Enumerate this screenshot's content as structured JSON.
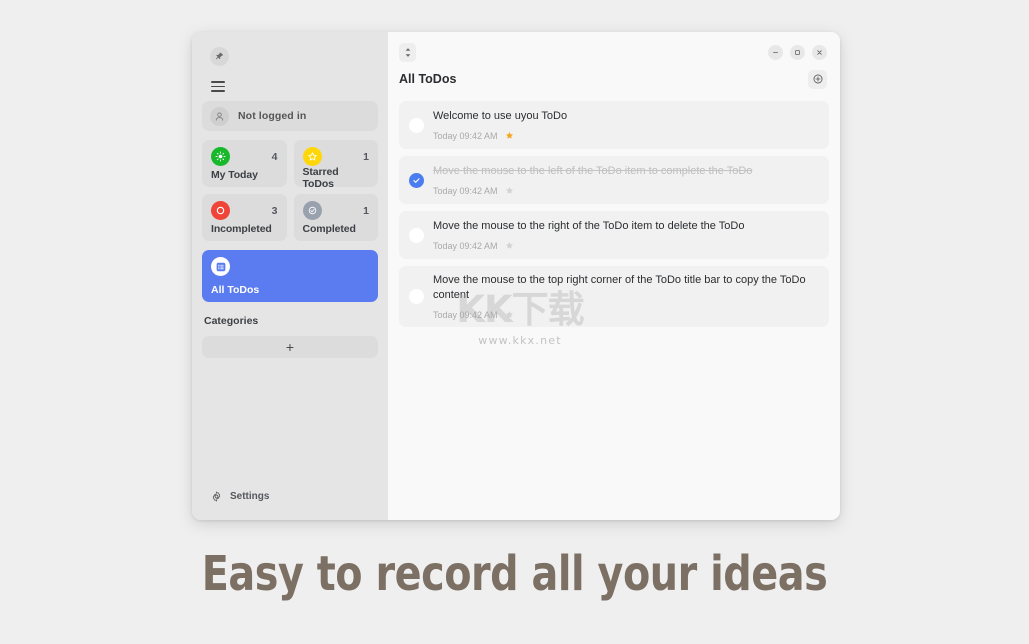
{
  "window": {
    "controls": [
      {
        "name": "minimize",
        "glyph": "–"
      },
      {
        "name": "maximize",
        "glyph": "□"
      },
      {
        "name": "close",
        "glyph": "×"
      }
    ]
  },
  "sidebar": {
    "pin_icon": "pin-icon",
    "menu_icon": "hamburger-icon",
    "account": {
      "label": "Not logged in",
      "icon": "person-icon"
    },
    "stats": [
      {
        "label": "My Today",
        "count": "4",
        "icon": "sun-icon",
        "color": "#17b92b"
      },
      {
        "label": "Starred ToDos",
        "count": "1",
        "icon": "star-icon",
        "color": "#ffd60a"
      },
      {
        "label": "Incompleted",
        "count": "3",
        "icon": "circle-icon",
        "color": "#f04438"
      },
      {
        "label": "Completed",
        "count": "1",
        "icon": "check-circle-icon",
        "color": "#9aa1ae"
      }
    ],
    "nav": {
      "label": "All ToDos",
      "icon": "list-icon",
      "accent": "#5b7cf0"
    },
    "categories": {
      "title": "Categories",
      "add_label": "+"
    },
    "settings": {
      "label": "Settings",
      "icon": "gear-icon"
    }
  },
  "main": {
    "sort_icon": "sort-updown-icon",
    "title": "All ToDos",
    "add_icon": "plus-circle-icon",
    "todos": [
      {
        "text": "Welcome to use uyou ToDo",
        "time": "Today 09:42 AM",
        "completed": false,
        "starred": true
      },
      {
        "text": "Move the mouse to the left of the ToDo item to complete the ToDo",
        "time": "Today 09:42 AM",
        "completed": true,
        "starred": false
      },
      {
        "text": "Move the mouse to the right of the ToDo item to delete the ToDo",
        "time": "Today 09:42 AM",
        "completed": false,
        "starred": false
      },
      {
        "text": "Move the mouse to the top right corner of the ToDo title bar to copy the ToDo content",
        "time": "Today 09:42 AM",
        "completed": false,
        "starred": false
      }
    ]
  },
  "watermark": {
    "text_cn": "KK下载",
    "url": "www.kkx.net"
  },
  "caption": {
    "text": "Easy to record all your ideas",
    "color": "#7c6f63"
  }
}
